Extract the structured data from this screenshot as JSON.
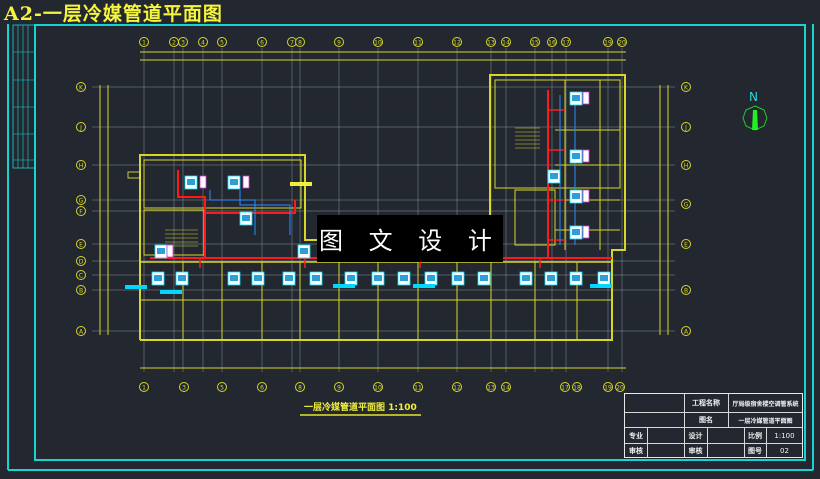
{
  "header": {
    "title": "A2-一层冷媒管道平面图"
  },
  "watermark": "图 文 设 计",
  "plan": {
    "caption": "一层冷媒管道平面图 1:100",
    "north_label": "N",
    "axes_top": [
      "1",
      "2",
      "3",
      "4",
      "5",
      "6",
      "7",
      "8",
      "9",
      "10",
      "11",
      "12",
      "13",
      "14",
      "15",
      "16",
      "17",
      "19",
      "20"
    ],
    "axes_bottom": [
      "1",
      "3",
      "5",
      "6",
      "8",
      "9",
      "10",
      "11",
      "12",
      "13",
      "14",
      "17",
      "18",
      "19",
      "20"
    ],
    "axes_left": [
      "K",
      "J",
      "H",
      "G",
      "F",
      "E",
      "D",
      "C",
      "B",
      "A"
    ],
    "axes_right": [
      "K",
      "J",
      "H",
      "G",
      "E",
      "B",
      "A"
    ]
  },
  "title_block": {
    "project_label": "工程名称",
    "project_value": "厅局级宿舍楼空调管系统",
    "drawing_label": "图名",
    "drawing_value": "一层冷媒管道平面图",
    "major_label": "专业",
    "design_label": "设计",
    "scale_label": "比例",
    "scale_value": "1:100",
    "review_label": "审核",
    "check_label": "审核",
    "number_label": "图号",
    "number_value": "02"
  },
  "colors": {
    "background": "#232830",
    "frame": "#19d3d3",
    "wall": "#d6d62a",
    "grid": "#8a8f96",
    "refrigerant_pipe": "#ff1a1a",
    "branch_pipe": "#2a8cff",
    "indoor_unit": "#ffffff"
  }
}
